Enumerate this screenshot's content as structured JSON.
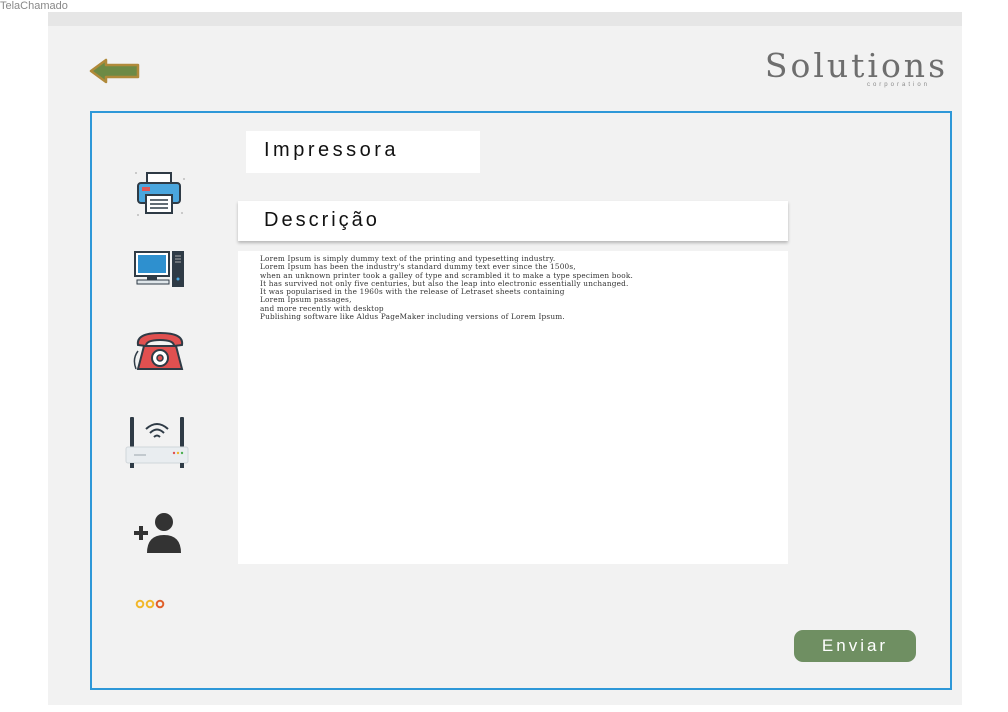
{
  "frame": {
    "label": "TelaChamado"
  },
  "header": {
    "back_icon": "arrow-left-icon",
    "logo": {
      "main": "Solutions",
      "sub": "corporation"
    }
  },
  "form": {
    "category": "Impressora",
    "description_title": "Descrição",
    "description_lines": [
      "Lorem Ipsum is simply dummy text of the printing and typesetting industry.",
      "Lorem Ipsum has been the industry's standard dummy text ever since the 1500s,",
      "when an unknown printer took a galley of type and scrambled it to make a type specimen book.",
      "It has survived not only five centuries, but also the leap into electronic essentially unchanged.",
      "It was popularised in the 1960s with the release of Letraset sheets containing",
      "Lorem Ipsum passages,",
      "and more recently with desktop",
      "Publishing software like Aldus PageMaker including versions of Lorem Ipsum."
    ],
    "submit_label": "Enviar"
  },
  "categories": [
    {
      "id": "printer",
      "icon": "printer-icon"
    },
    {
      "id": "computer",
      "icon": "computer-icon"
    },
    {
      "id": "phone",
      "icon": "telephone-icon"
    },
    {
      "id": "router",
      "icon": "wifi-router-icon"
    },
    {
      "id": "add-user",
      "icon": "add-user-icon"
    },
    {
      "id": "more",
      "icon": "more-dots-icon"
    }
  ],
  "colors": {
    "accent_border": "#2e98d8",
    "submit_button": "#6f8f62",
    "back_arrow": "#6d8a45"
  }
}
